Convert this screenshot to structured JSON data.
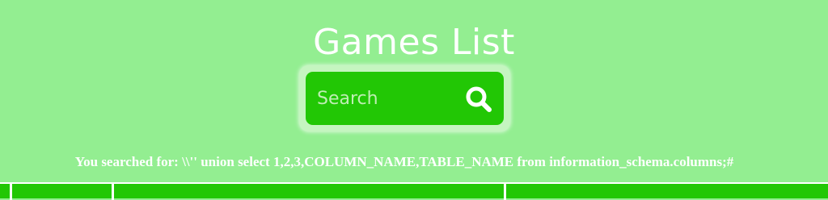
{
  "header": {
    "title": "Games List"
  },
  "search": {
    "placeholder": "Search",
    "value": "",
    "button_icon": "search-icon"
  },
  "result": {
    "searched_for_text": "You searched for: \\\\'' union select 1,2,3,COLUMN_NAME,TABLE_NAME from information_schema.columns;#"
  },
  "colors": {
    "background": "#93ee91",
    "search_green": "#22c705",
    "search_glow": "#c5f5c0",
    "text": "#ffffff"
  }
}
